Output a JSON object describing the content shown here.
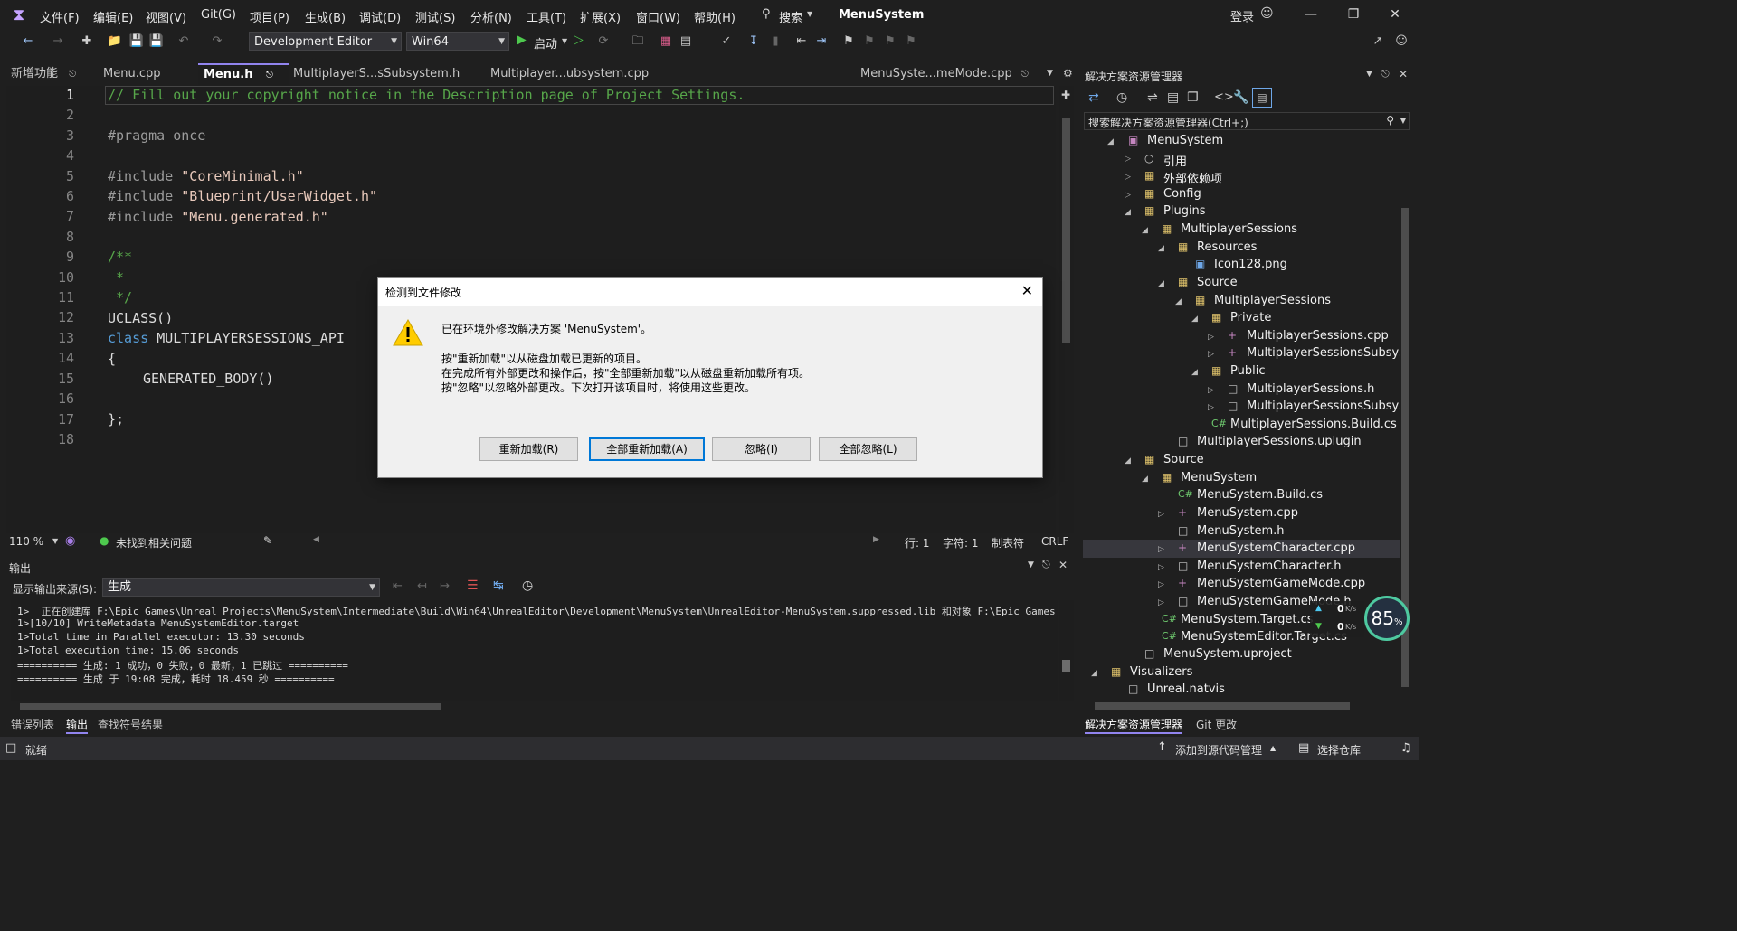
{
  "menubar": {
    "items": [
      "文件(F)",
      "编辑(E)",
      "视图(V)",
      "Git(G)",
      "项目(P)",
      "生成(B)",
      "调试(D)",
      "测试(S)",
      "分析(N)",
      "工具(T)",
      "扩展(X)",
      "窗口(W)",
      "帮助(H)"
    ],
    "search_label": "搜索",
    "app_title": "MenuSystem",
    "login_label": "登录"
  },
  "toolbar": {
    "config": "Development Editor",
    "platform": "Win64",
    "start_label": "启动"
  },
  "doc_tabs": {
    "left_tab": "新增功能",
    "tabs": [
      "Menu.cpp",
      "Menu.h",
      "MultiplayerS...sSubsystem.h",
      "Multiplayer...ubsystem.cpp"
    ],
    "right_tab": "MenuSyste...meMode.cpp"
  },
  "editor": {
    "line_numbers": [
      "1",
      "2",
      "3",
      "4",
      "5",
      "6",
      "7",
      "8",
      "9",
      "10",
      "11",
      "12",
      "13",
      "14",
      "15",
      "16",
      "17",
      "18"
    ],
    "line1": "// Fill out your copyright notice in the Description page of Project Settings.",
    "line3": "#pragma once",
    "inc5_kw": "#include",
    "inc5_str": "\"CoreMinimal.h\"",
    "inc6_kw": "#include",
    "inc6_str": "\"Blueprint/UserWidget.h\"",
    "inc7_kw": "#include",
    "inc7_str": "\"Menu.generated.h\"",
    "line9": "/**",
    "line10": " *",
    "line11": " */",
    "line12": "UCLASS()",
    "line13_kw": "class",
    "line13_rest": "MULTIPLAYERSESSIONS_API",
    "line14": "{",
    "line15": "GENERATED_BODY()",
    "line17": "};"
  },
  "editor_status": {
    "zoom": "110 %",
    "issues": "未找到相关问题",
    "line": "行: 1",
    "char": "字符: 1",
    "tabs": "制表符",
    "eol": "CRLF"
  },
  "output": {
    "title": "输出",
    "source_label": "显示输出来源(S):",
    "source_value": "生成",
    "lines": [
      "1>  正在创建库 F:\\Epic Games\\Unreal Projects\\MenuSystem\\Intermediate\\Build\\Win64\\UnrealEditor\\Development\\MenuSystem\\UnrealEditor-MenuSystem.suppressed.lib 和对象 F:\\Epic Games",
      "1>[10/10] WriteMetadata MenuSystemEditor.target",
      "1>Total time in Parallel executor: 13.30 seconds",
      "1>Total execution time: 15.06 seconds",
      "========== 生成: 1 成功，0 失败，0 最新，1 已跳过 ==========",
      "========== 生成 于 19:08 完成，耗时 18.459 秒 =========="
    ]
  },
  "bottom_tabs": [
    "错误列表",
    "输出",
    "查找符号结果"
  ],
  "statusbar": {
    "ready": "就绪",
    "add_source": "添加到源代码管理",
    "select_repo": "选择仓库"
  },
  "solution": {
    "title": "解决方案资源管理器",
    "search_placeholder": "搜索解决方案资源管理器(Ctrl+;)",
    "items": [
      "MenuSystem",
      "引用",
      "外部依赖项",
      "Config",
      "Plugins",
      "MultiplayerSessions",
      "Resources",
      "Icon128.png",
      "Source",
      "MultiplayerSessions",
      "Private",
      "MultiplayerSessions.cpp",
      "MultiplayerSessionsSubsyst",
      "Public",
      "MultiplayerSessions.h",
      "MultiplayerSessionsSubsyst",
      "MultiplayerSessions.Build.cs",
      "MultiplayerSessions.uplugin",
      "Source",
      "MenuSystem",
      "MenuSystem.Build.cs",
      "MenuSystem.cpp",
      "MenuSystem.h",
      "MenuSystemCharacter.cpp",
      "MenuSystemCharacter.h",
      "MenuSystemGameMode.cpp",
      "MenuSystemGameMode.h",
      "MenuSystem.Target.cs",
      "MenuSystemEditor.Target.cs",
      "MenuSystem.uproject",
      "Visualizers",
      "Unreal.natvis"
    ],
    "bottom_tabs": [
      "解决方案资源管理器",
      "Git 更改"
    ],
    "net_up": "0",
    "net_down": "0",
    "net_unit": "K/s",
    "cpu_percent": "85",
    "cpu_unit": "%"
  },
  "dialog": {
    "title": "检测到文件修改",
    "msg1": "已在环境外修改解决方案 'MenuSystem'。",
    "msg2": "按\"重新加载\"以从磁盘加载已更新的项目。",
    "msg3": "在完成所有外部更改和操作后，按\"全部重新加载\"以从磁盘重新加载所有项。",
    "msg4": "按\"忽略\"以忽略外部更改。下次打开该项目时，将使用这些更改。",
    "btn_reload": "重新加载(R)",
    "btn_reload_all": "全部重新加载(A)",
    "btn_ignore": "忽略(I)",
    "btn_ignore_all": "全部忽略(L)"
  }
}
